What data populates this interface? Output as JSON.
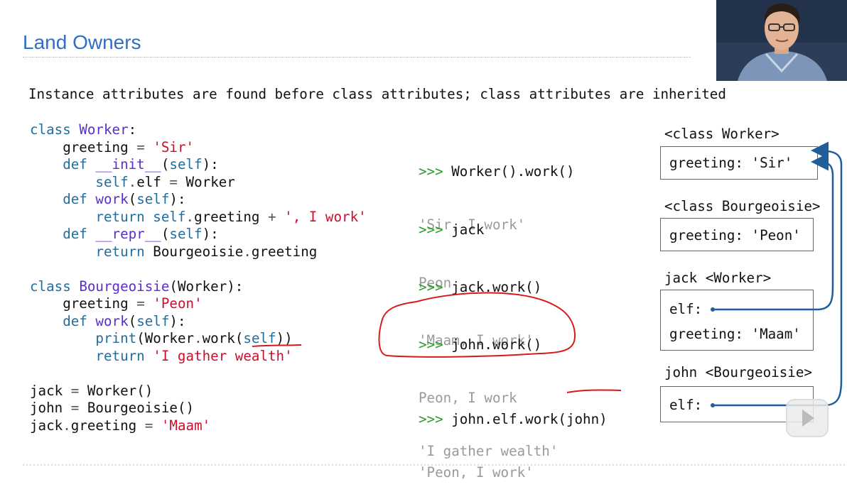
{
  "slide": {
    "title": "Land Owners",
    "subtitle": "Instance attributes are found before class attributes; class attributes are inherited"
  },
  "code_lines": [
    [
      {
        "t": "class ",
        "c": "kw"
      },
      {
        "t": "Worker",
        "c": "cls"
      },
      {
        "t": ":",
        "c": ""
      }
    ],
    [
      {
        "t": "    greeting ",
        "c": ""
      },
      {
        "t": "=",
        "c": "op"
      },
      {
        "t": " ",
        "c": ""
      },
      {
        "t": "'Sir'",
        "c": "str"
      }
    ],
    [
      {
        "t": "    def ",
        "c": "kw"
      },
      {
        "t": "__init__",
        "c": "cls"
      },
      {
        "t": "(",
        "c": ""
      },
      {
        "t": "self",
        "c": "kw"
      },
      {
        "t": "):",
        "c": ""
      }
    ],
    [
      {
        "t": "        ",
        "c": ""
      },
      {
        "t": "self",
        "c": "kw"
      },
      {
        "t": ".",
        "c": "op"
      },
      {
        "t": "elf ",
        "c": ""
      },
      {
        "t": "=",
        "c": "op"
      },
      {
        "t": " Worker",
        "c": ""
      }
    ],
    [
      {
        "t": "    def ",
        "c": "kw"
      },
      {
        "t": "work",
        "c": "cls"
      },
      {
        "t": "(",
        "c": ""
      },
      {
        "t": "self",
        "c": "kw"
      },
      {
        "t": "):",
        "c": ""
      }
    ],
    [
      {
        "t": "        return ",
        "c": "kw"
      },
      {
        "t": "self",
        "c": "kw"
      },
      {
        "t": ".",
        "c": "op"
      },
      {
        "t": "greeting ",
        "c": ""
      },
      {
        "t": "+",
        "c": "op"
      },
      {
        "t": " ",
        "c": ""
      },
      {
        "t": "', I work'",
        "c": "str"
      }
    ],
    [
      {
        "t": "    def ",
        "c": "kw"
      },
      {
        "t": "__repr__",
        "c": "cls"
      },
      {
        "t": "(",
        "c": ""
      },
      {
        "t": "self",
        "c": "kw"
      },
      {
        "t": "):",
        "c": ""
      }
    ],
    [
      {
        "t": "        return ",
        "c": "kw"
      },
      {
        "t": "Bourgeoisie",
        "c": ""
      },
      {
        "t": ".",
        "c": "op"
      },
      {
        "t": "greeting",
        "c": ""
      }
    ],
    [
      {
        "t": "",
        "c": ""
      }
    ],
    [
      {
        "t": "class ",
        "c": "kw"
      },
      {
        "t": "Bourgeoisie",
        "c": "cls"
      },
      {
        "t": "(Worker):",
        "c": ""
      }
    ],
    [
      {
        "t": "    greeting ",
        "c": ""
      },
      {
        "t": "=",
        "c": "op"
      },
      {
        "t": " ",
        "c": ""
      },
      {
        "t": "'Peon'",
        "c": "str"
      }
    ],
    [
      {
        "t": "    def ",
        "c": "kw"
      },
      {
        "t": "work",
        "c": "cls"
      },
      {
        "t": "(",
        "c": ""
      },
      {
        "t": "self",
        "c": "kw"
      },
      {
        "t": "):",
        "c": ""
      }
    ],
    [
      {
        "t": "        print",
        "c": "kw"
      },
      {
        "t": "(Worker",
        "c": ""
      },
      {
        "t": ".",
        "c": "op"
      },
      {
        "t": "work(",
        "c": ""
      },
      {
        "t": "self",
        "c": "kw"
      },
      {
        "t": "))",
        "c": ""
      }
    ],
    [
      {
        "t": "        return ",
        "c": "kw"
      },
      {
        "t": "'I gather wealth'",
        "c": "str"
      }
    ],
    [
      {
        "t": "",
        "c": ""
      }
    ],
    [
      {
        "t": "jack ",
        "c": ""
      },
      {
        "t": "=",
        "c": "op"
      },
      {
        "t": " Worker()",
        "c": ""
      }
    ],
    [
      {
        "t": "john ",
        "c": ""
      },
      {
        "t": "=",
        "c": "op"
      },
      {
        "t": " Bourgeoisie()",
        "c": ""
      }
    ],
    [
      {
        "t": "jack",
        "c": ""
      },
      {
        "t": ".",
        "c": "op"
      },
      {
        "t": "greeting ",
        "c": ""
      },
      {
        "t": "=",
        "c": "op"
      },
      {
        "t": " ",
        "c": ""
      },
      {
        "t": "'Maam'",
        "c": "str"
      }
    ]
  ],
  "session": [
    {
      "prompt": ">>> ",
      "input": "Worker().work()",
      "output": [
        "'Sir, I work'"
      ]
    },
    {
      "prompt": ">>> ",
      "input": "jack",
      "output": [
        "Peon"
      ]
    },
    {
      "prompt": ">>> ",
      "input": "jack.work()",
      "output": [
        "'Maam, I work'"
      ]
    },
    {
      "prompt": ">>> ",
      "input": "john.work()",
      "output": [
        "Peon, I work",
        "'I gather wealth'"
      ]
    },
    {
      "prompt": ">>> ",
      "input": "john.elf.work(john)",
      "output": [
        "'Peon, I work'"
      ]
    }
  ],
  "diagram": {
    "worker_label": "<class Worker>",
    "worker_attr": "greeting: 'Sir'",
    "bourg_label": "<class Bourgeoisie>",
    "bourg_attr": "greeting: 'Peon'",
    "jack_label": "jack <Worker>",
    "jack_elf": "elf:",
    "jack_greeting": "greeting: 'Maam'",
    "john_label": "john <Bourgeoisie>",
    "john_elf": "elf:"
  },
  "colors": {
    "title": "#2f6fc6",
    "keyword": "#1f6e9e",
    "name": "#5a2fc9",
    "string": "#c8102e",
    "prompt": "#2a9d2a",
    "arrow": "#1f5e9a",
    "annotation": "#d61a1a"
  },
  "icons": {
    "play_button": "play-icon",
    "video": "presenter-video-thumbnail"
  }
}
